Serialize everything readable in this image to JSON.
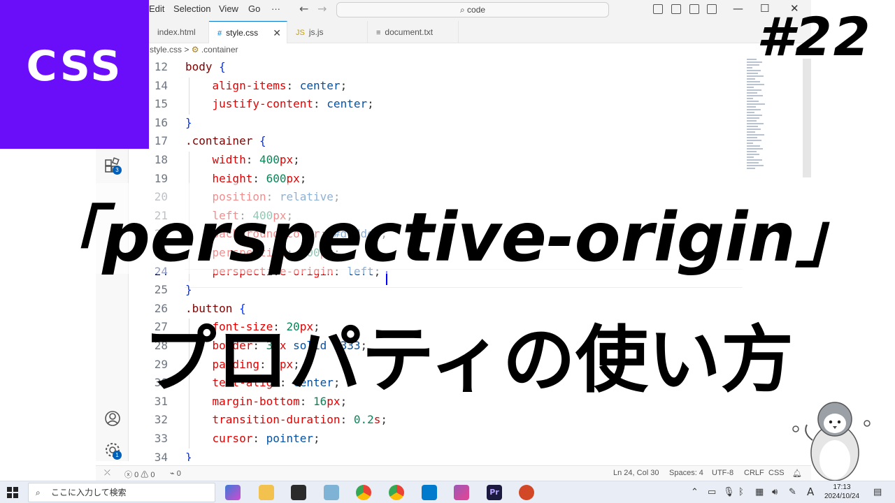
{
  "menu": [
    "Edit",
    "Selection",
    "View",
    "Go",
    "···"
  ],
  "command_center": "code",
  "tabs": [
    {
      "label": "index.html",
      "icon": "<>",
      "active": false
    },
    {
      "label": "style.css",
      "icon": "#",
      "active": true
    },
    {
      "label": "js.js",
      "icon": "JS",
      "active": false
    },
    {
      "label": "document.txt",
      "icon": "≡",
      "active": false
    }
  ],
  "breadcrumb": {
    "file": "style.css",
    "sep": ">",
    "symbol": ".container"
  },
  "activity_badges": {
    "extensions": "3",
    "settings": "1"
  },
  "editor": {
    "lines": [
      {
        "n": "12",
        "parts": [
          [
            "sel",
            "body"
          ],
          [
            "punc",
            " "
          ],
          [
            "brace",
            "{"
          ]
        ]
      },
      {
        "n": "14",
        "parts": [
          [
            "punc",
            "    "
          ],
          [
            "prop",
            "align-items"
          ],
          [
            "punc",
            ": "
          ],
          [
            "val",
            "center"
          ],
          [
            "punc",
            ";"
          ]
        ]
      },
      {
        "n": "15",
        "parts": [
          [
            "punc",
            "    "
          ],
          [
            "prop",
            "justify-content"
          ],
          [
            "punc",
            ": "
          ],
          [
            "val",
            "center"
          ],
          [
            "punc",
            ";"
          ]
        ]
      },
      {
        "n": "16",
        "parts": [
          [
            "brace",
            "}"
          ]
        ]
      },
      {
        "n": "17",
        "parts": [
          [
            "sel",
            ".container"
          ],
          [
            "punc",
            " "
          ],
          [
            "brace",
            "{"
          ]
        ]
      },
      {
        "n": "18",
        "parts": [
          [
            "punc",
            "    "
          ],
          [
            "prop",
            "width"
          ],
          [
            "punc",
            ": "
          ],
          [
            "num",
            "400"
          ],
          [
            "prop",
            "px"
          ],
          [
            "punc",
            ";"
          ]
        ]
      },
      {
        "n": "19",
        "parts": [
          [
            "punc",
            "    "
          ],
          [
            "prop",
            "height"
          ],
          [
            "punc",
            ": "
          ],
          [
            "num",
            "600"
          ],
          [
            "prop",
            "px"
          ],
          [
            "punc",
            ";"
          ]
        ]
      },
      {
        "n": "20",
        "parts": [
          [
            "punc",
            "    "
          ],
          [
            "prop",
            "position"
          ],
          [
            "punc",
            ": "
          ],
          [
            "val",
            "relative"
          ],
          [
            "punc",
            ";"
          ]
        ]
      },
      {
        "n": "21",
        "parts": [
          [
            "punc",
            "    "
          ],
          [
            "prop",
            "left"
          ],
          [
            "punc",
            ": "
          ],
          [
            "num",
            "400"
          ],
          [
            "prop",
            "px"
          ],
          [
            "punc",
            ";"
          ]
        ]
      },
      {
        "n": "22",
        "parts": [
          [
            "punc",
            "    "
          ],
          [
            "prop",
            "background-color"
          ],
          [
            "punc",
            ": "
          ],
          [
            "val",
            "#dddddd"
          ],
          [
            "punc",
            ";"
          ]
        ]
      },
      {
        "n": "23",
        "parts": [
          [
            "punc",
            "    "
          ],
          [
            "prop",
            "perspective"
          ],
          [
            "punc",
            ": "
          ],
          [
            "num",
            "800"
          ],
          [
            "prop",
            "px"
          ],
          [
            "punc",
            ";"
          ]
        ]
      },
      {
        "n": "24",
        "parts": [
          [
            "punc",
            "    "
          ],
          [
            "prop",
            "perspective-origin"
          ],
          [
            "punc",
            ": "
          ],
          [
            "val",
            "left"
          ],
          [
            "punc",
            ";"
          ]
        ]
      },
      {
        "n": "25",
        "parts": [
          [
            "brace",
            "}"
          ]
        ]
      },
      {
        "n": "26",
        "parts": [
          [
            "sel",
            ".button"
          ],
          [
            "punc",
            " "
          ],
          [
            "brace",
            "{"
          ]
        ]
      },
      {
        "n": "27",
        "parts": [
          [
            "punc",
            "    "
          ],
          [
            "prop",
            "font-size"
          ],
          [
            "punc",
            ": "
          ],
          [
            "num",
            "20"
          ],
          [
            "prop",
            "px"
          ],
          [
            "punc",
            ";"
          ]
        ]
      },
      {
        "n": "28",
        "parts": [
          [
            "punc",
            "    "
          ],
          [
            "prop",
            "border"
          ],
          [
            "punc",
            ": "
          ],
          [
            "num",
            "3"
          ],
          [
            "prop",
            "px"
          ],
          [
            "punc",
            " "
          ],
          [
            "val",
            "solid #333"
          ],
          [
            "punc",
            ";"
          ]
        ]
      },
      {
        "n": "29",
        "parts": [
          [
            "punc",
            "    "
          ],
          [
            "prop",
            "padding"
          ],
          [
            "punc",
            ": "
          ],
          [
            "num",
            "8"
          ],
          [
            "prop",
            "px"
          ],
          [
            "punc",
            ";"
          ]
        ]
      },
      {
        "n": "30",
        "parts": [
          [
            "punc",
            "    "
          ],
          [
            "prop",
            "text-align"
          ],
          [
            "punc",
            ": "
          ],
          [
            "val",
            "center"
          ],
          [
            "punc",
            ";"
          ]
        ]
      },
      {
        "n": "31",
        "parts": [
          [
            "punc",
            "    "
          ],
          [
            "prop",
            "margin-bottom"
          ],
          [
            "punc",
            ": "
          ],
          [
            "num",
            "16"
          ],
          [
            "prop",
            "px"
          ],
          [
            "punc",
            ";"
          ]
        ]
      },
      {
        "n": "32",
        "parts": [
          [
            "punc",
            "    "
          ],
          [
            "prop",
            "transition-duration"
          ],
          [
            "punc",
            ": "
          ],
          [
            "num",
            "0.2"
          ],
          [
            "prop",
            "s"
          ],
          [
            "punc",
            ";"
          ]
        ]
      },
      {
        "n": "33",
        "parts": [
          [
            "punc",
            "    "
          ],
          [
            "prop",
            "cursor"
          ],
          [
            "punc",
            ": "
          ],
          [
            "val",
            "pointer"
          ],
          [
            "punc",
            ";"
          ]
        ]
      },
      {
        "n": "34",
        "parts": [
          [
            "brace",
            "}"
          ]
        ]
      }
    ],
    "current_line": "24"
  },
  "status": {
    "errors": "0",
    "warnings": "0",
    "ports": "0",
    "position": "Ln 24, Col 30",
    "spaces": "Spaces: 4",
    "encoding": "UTF-8",
    "eol": "CRLF",
    "language": "CSS"
  },
  "taskbar": {
    "search_placeholder": "ここに入力して検索",
    "time": "17:13",
    "date": "2024/10/24",
    "ime": "A"
  },
  "overlay": {
    "badge": "CSS",
    "episode": "#22",
    "title_en": "「perspective-origin」",
    "title_jp": "プロパティの使い方"
  },
  "colors": {
    "badge_bg": "#6a0df8",
    "accent": "#0078d4"
  }
}
